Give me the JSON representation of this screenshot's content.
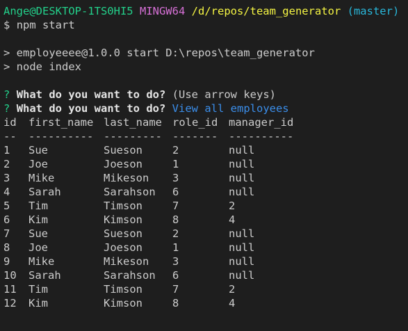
{
  "prompt": {
    "user": "Ange@DESKTOP-1TS0HI5",
    "shell": "MINGW64",
    "path": "/d/repos/team_generator",
    "branch": "(master)",
    "symbol": "$",
    "command": "npm start"
  },
  "npm_lines": [
    "> employeeee@1.0.0 start D:\\repos\\team_generator",
    "> node index"
  ],
  "questions": [
    {
      "mark": "?",
      "text": "What do you want to do?",
      "hint": "(Use arrow keys)",
      "answer": ""
    },
    {
      "mark": "?",
      "text": "What do you want to do?",
      "hint": "",
      "answer": "View all employees"
    }
  ],
  "table": {
    "headers": [
      "id",
      "first_name",
      "last_name",
      "role_id",
      "manager_id"
    ],
    "separators": [
      "--",
      "----------",
      "---------",
      "-------",
      "----------"
    ],
    "rows": [
      [
        "1",
        "Sue",
        "Sueson",
        "2",
        "null"
      ],
      [
        "2",
        "Joe",
        "Joeson",
        "1",
        "null"
      ],
      [
        "3",
        "Mike",
        "Mikeson",
        "3",
        "null"
      ],
      [
        "4",
        "Sarah",
        "Sarahson",
        "6",
        "null"
      ],
      [
        "5",
        "Tim",
        "Timson",
        "7",
        "2"
      ],
      [
        "6",
        "Kim",
        "Kimson",
        "8",
        "4"
      ],
      [
        "7",
        "Sue",
        "Sueson",
        "2",
        "null"
      ],
      [
        "8",
        "Joe",
        "Joeson",
        "1",
        "null"
      ],
      [
        "9",
        "Mike",
        "Mikeson",
        "3",
        "null"
      ],
      [
        "10",
        "Sarah",
        "Sarahson",
        "6",
        "null"
      ],
      [
        "11",
        "Tim",
        "Timson",
        "7",
        "2"
      ],
      [
        "12",
        "Kim",
        "Kimson",
        "8",
        "4"
      ]
    ]
  }
}
